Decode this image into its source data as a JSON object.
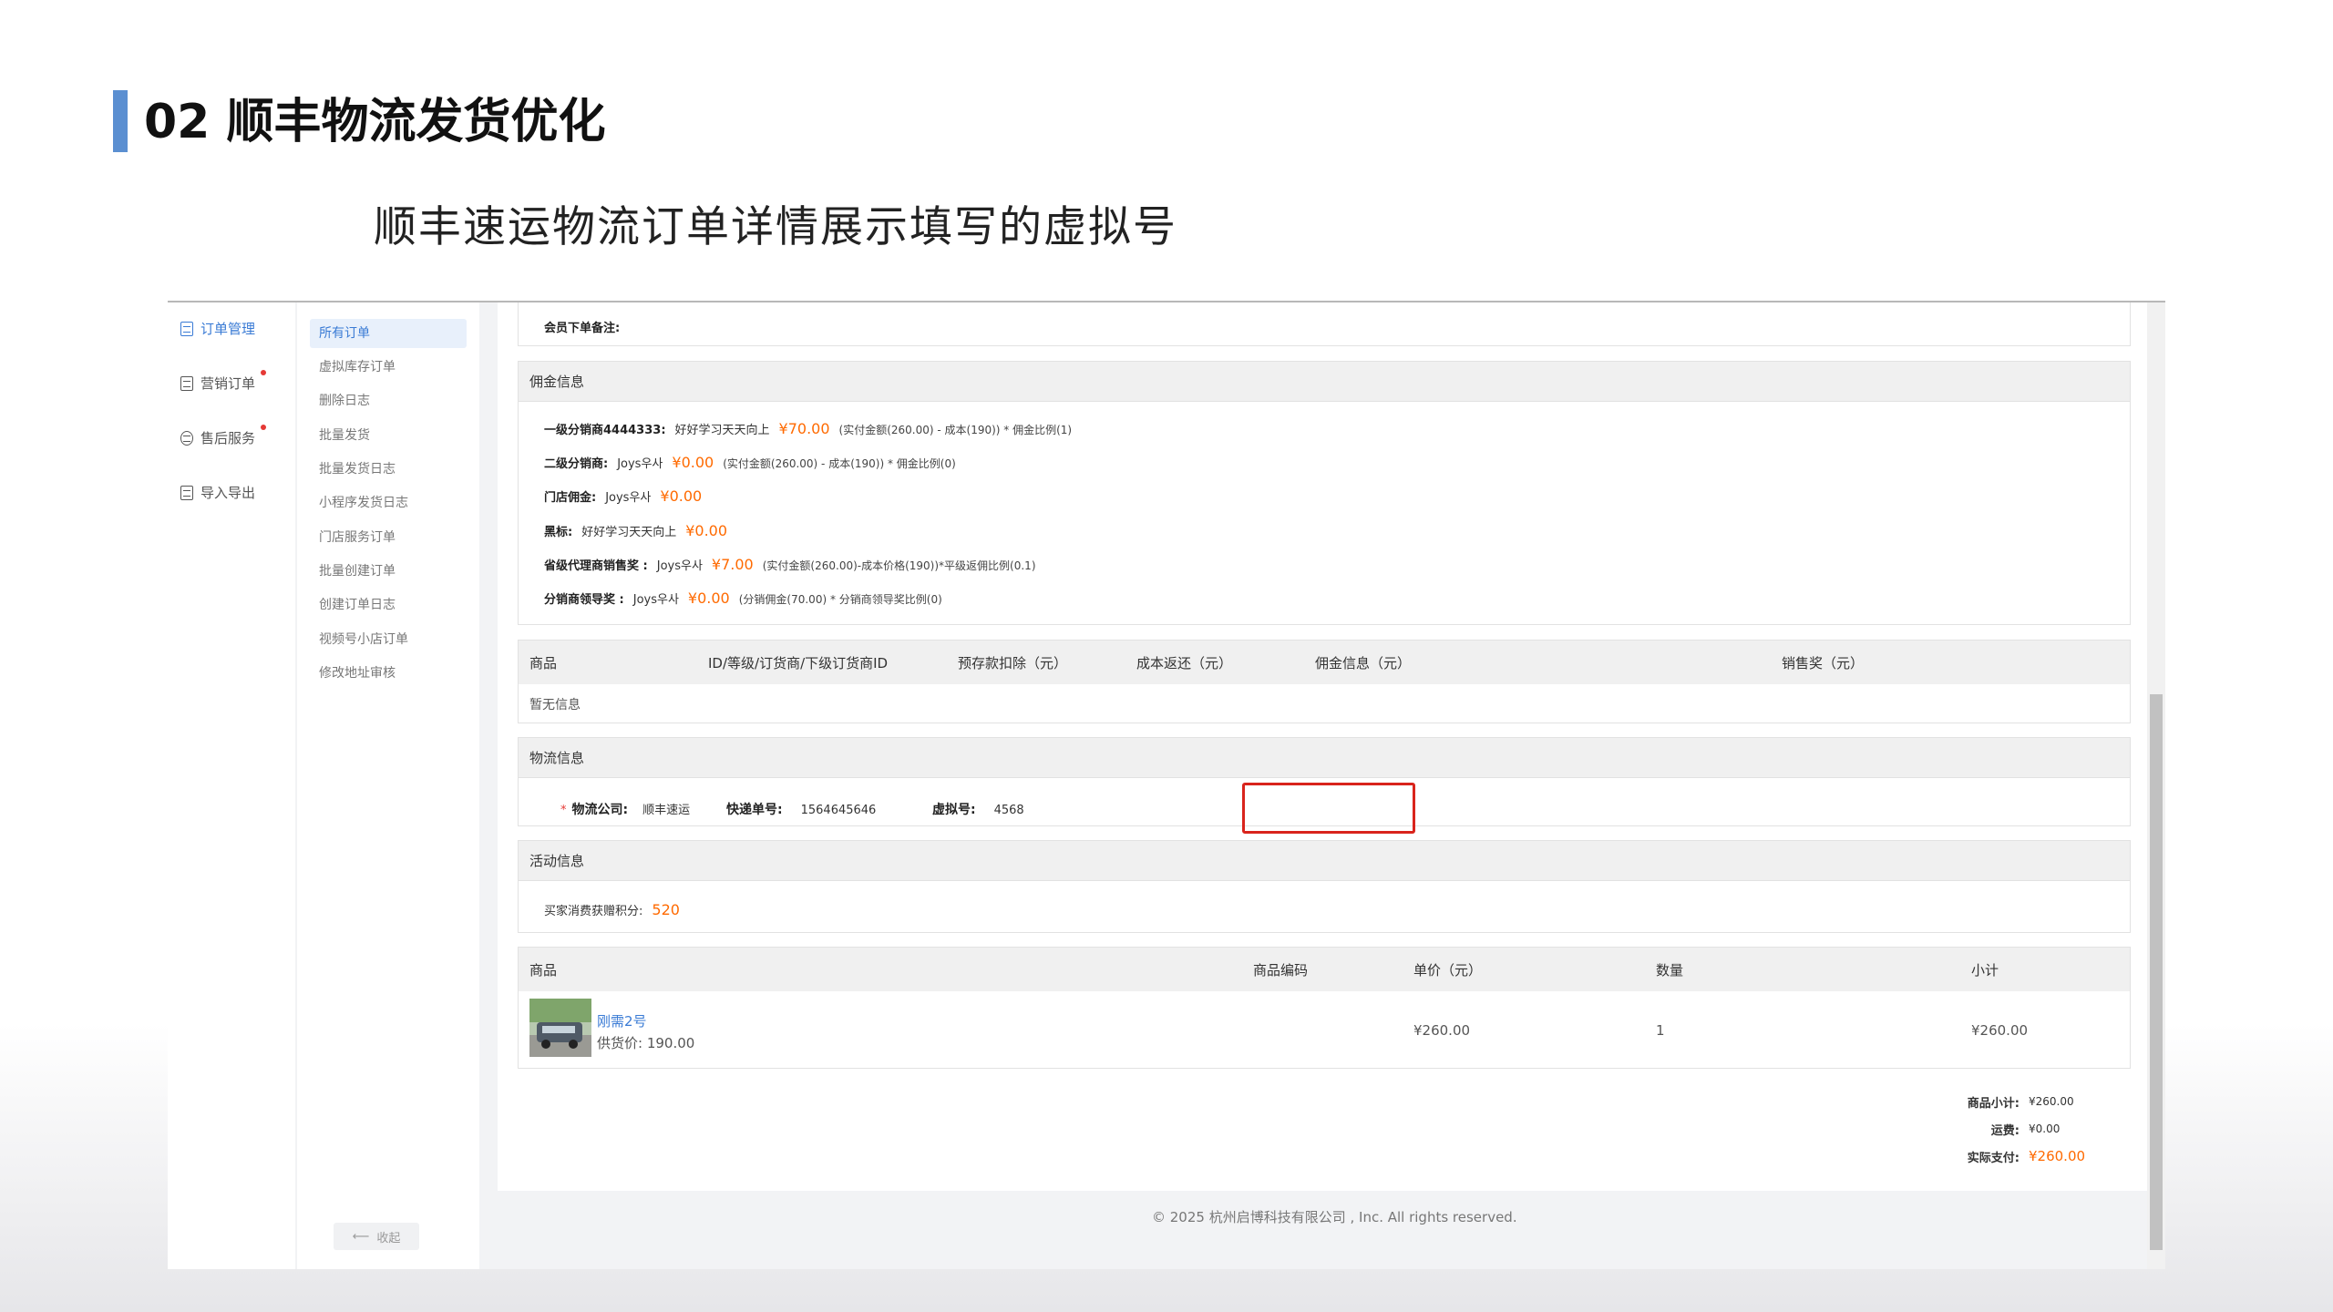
{
  "slide": {
    "title": "02 顺丰物流发货优化",
    "subtitle": "顺丰速运物流订单详情展示填写的虚拟号"
  },
  "nav_primary": [
    {
      "label": "订单管理",
      "active": true
    },
    {
      "label": "营销订单",
      "dot": true
    },
    {
      "label": "售后服务",
      "dot": true
    },
    {
      "label": "导入导出"
    }
  ],
  "nav_secondary": {
    "items": [
      "所有订单",
      "虚拟库存订单",
      "删除日志",
      "批量发货",
      "批量发货日志",
      "小程序发货日志",
      "门店服务订单",
      "批量创建订单",
      "创建订单日志",
      "视频号小店订单",
      "修改地址审核"
    ],
    "collapse_label": "收起"
  },
  "member_note": {
    "label": "会员下单备注:"
  },
  "commission": {
    "title": "佣金信息",
    "rows": [
      {
        "label": "一级分销商4444333:",
        "name": "好好学习天天向上",
        "amount": "¥70.00",
        "detail": "(实付金额(260.00) - 成本(190)) * 佣金比例(1)"
      },
      {
        "label": "二级分销商:",
        "name": "Joys우사",
        "amount": "¥0.00",
        "detail": "(实付金额(260.00) - 成本(190)) * 佣金比例(0)"
      },
      {
        "label": "门店佣金:",
        "name": "Joys우사",
        "amount": "¥0.00",
        "detail": ""
      },
      {
        "label": "黑标:",
        "name": "好好学习天天向上",
        "amount": "¥0.00",
        "detail": ""
      },
      {
        "label": "省级代理商销售奖 :",
        "name": "Joys우사",
        "amount": "¥7.00",
        "detail": "(实付金额(260.00)-成本价格(190))*平级返佣比例(0.1)"
      },
      {
        "label": "分销商领导奖 :",
        "name": "Joys우사",
        "amount": "¥0.00",
        "detail": "(分销佣金(70.00) * 分销商领导奖比例(0)"
      }
    ]
  },
  "prepay_table": {
    "headers": [
      "商品",
      "ID/等级/订货商/下级订货商ID",
      "预存款扣除（元）",
      "成本返还（元）",
      "佣金信息（元）",
      "销售奖（元）"
    ],
    "empty_text": "暂无信息"
  },
  "logistics": {
    "title": "物流信息",
    "required_mark": "*",
    "company_label": "物流公司:",
    "company_value": "顺丰速运",
    "tracking_label": "快递单号:",
    "tracking_value": "1564645646",
    "virtual_label": "虚拟号:",
    "virtual_value": "4568"
  },
  "activity": {
    "title": "活动信息",
    "points_label": "买家消费获赠积分:",
    "points_value": "520"
  },
  "goods_table": {
    "headers": [
      "商品",
      "商品编码",
      "单价（元）",
      "数量",
      "小计"
    ],
    "rows": [
      {
        "name": "刚需2号",
        "supply_price": "供货价: 190.00",
        "code": "",
        "price": "¥260.00",
        "qty": "1",
        "subtotal": "¥260.00"
      }
    ]
  },
  "summary": {
    "goods_label": "商品小计:",
    "goods_value": "¥260.00",
    "shipping_label": "运费:",
    "shipping_value": "¥0.00",
    "paid_label": "实际支付:",
    "paid_value": "¥260.00"
  },
  "footer": {
    "copyright": "© 2025 杭州启博科技有限公司 , Inc. All rights reserved."
  },
  "colors": {
    "accent": "#3a7bd5",
    "price": "#ff6a00",
    "highlight": "#d9241c",
    "slide_bar": "#5b8fd1"
  }
}
